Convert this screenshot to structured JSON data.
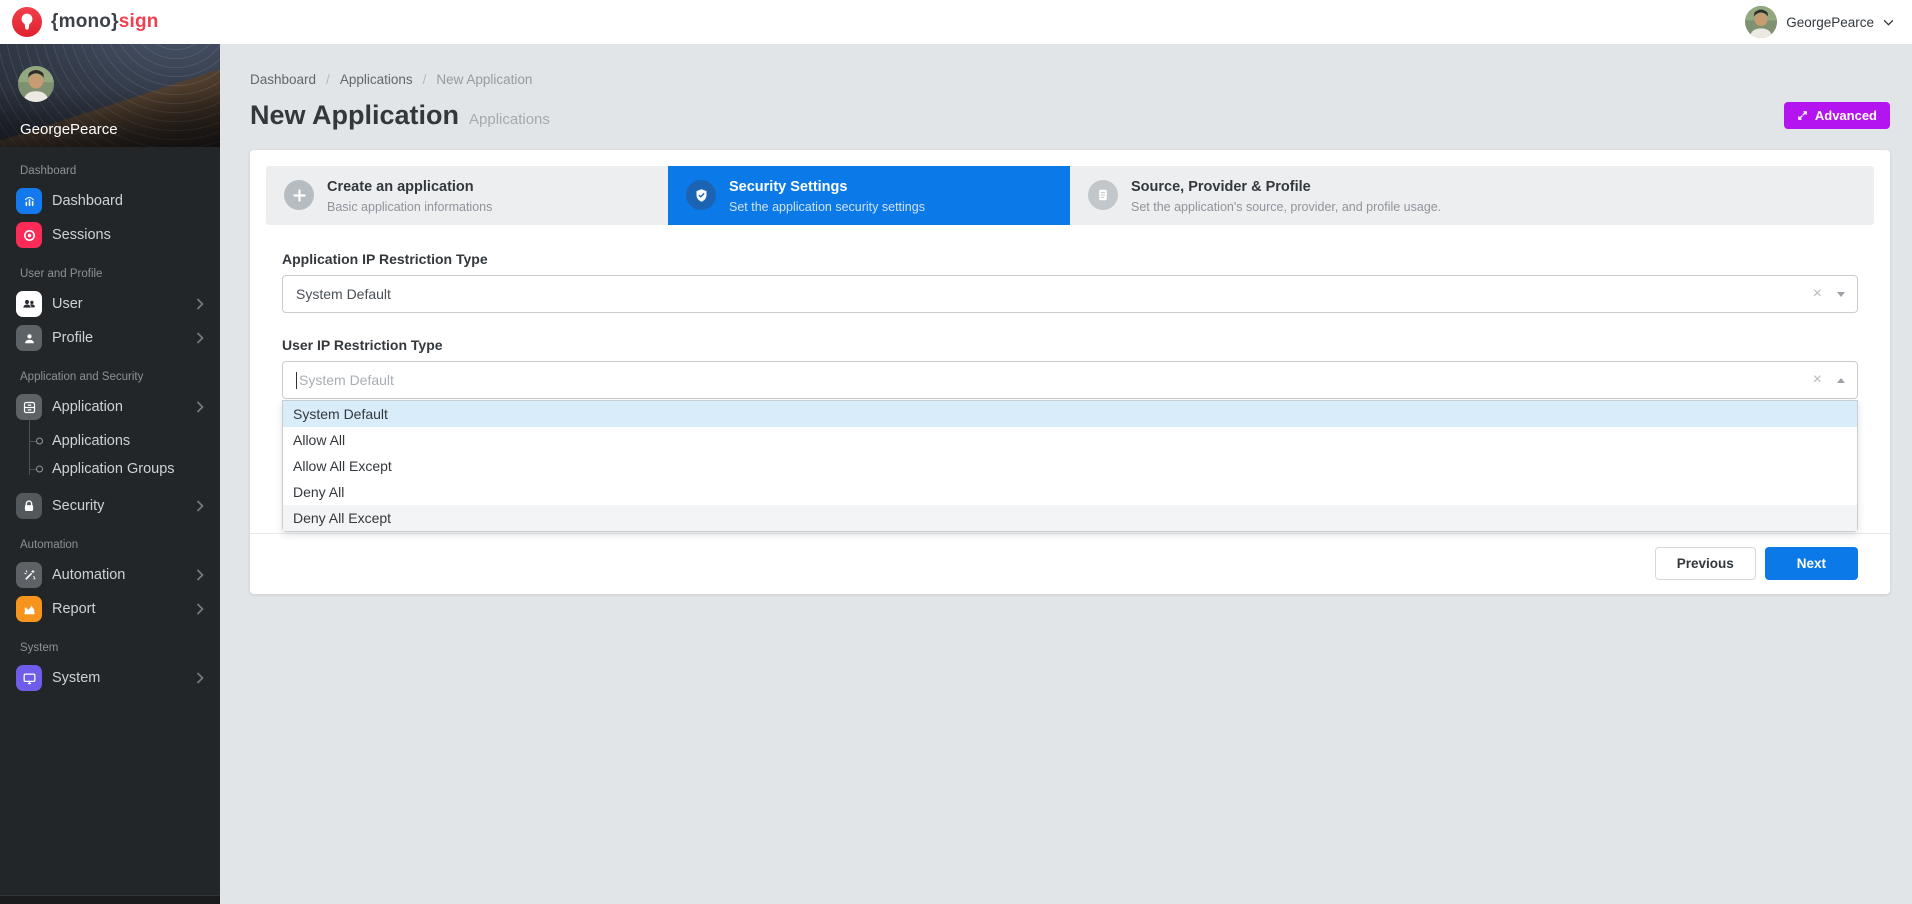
{
  "topbar": {
    "brand_left": "{mono}",
    "brand_right": "sign",
    "user_name": "GeorgePearce"
  },
  "sidebar": {
    "profile_name": "GeorgePearce",
    "sections": [
      {
        "label": "Dashboard",
        "items": [
          {
            "label": "Dashboard",
            "icon": "chart-icon"
          },
          {
            "label": "Sessions",
            "icon": "record-icon"
          }
        ]
      },
      {
        "label": "User and Profile",
        "items": [
          {
            "label": "User",
            "icon": "users-icon"
          },
          {
            "label": "Profile",
            "icon": "person-icon"
          }
        ]
      },
      {
        "label": "Application and Security",
        "items": [
          {
            "label": "Application",
            "icon": "archive-icon",
            "children": [
              "Applications",
              "Application Groups"
            ]
          },
          {
            "label": "Security",
            "icon": "lock-icon"
          }
        ]
      },
      {
        "label": "Automation",
        "items": [
          {
            "label": "Automation",
            "icon": "wand-icon"
          },
          {
            "label": "Report",
            "icon": "report-icon"
          }
        ]
      },
      {
        "label": "System",
        "items": [
          {
            "label": "System",
            "icon": "monitor-icon"
          }
        ]
      }
    ]
  },
  "breadcrumb": {
    "items": [
      "Dashboard",
      "Applications",
      "New Application"
    ],
    "separator": "/"
  },
  "page": {
    "title": "New Application",
    "subtitle": "Applications"
  },
  "toolbar": {
    "advanced_label": "Advanced"
  },
  "wizard": {
    "steps": [
      {
        "title": "Create an application",
        "subtitle": "Basic application informations",
        "state": "default"
      },
      {
        "title": "Security Settings",
        "subtitle": "Set the application security settings",
        "state": "active"
      },
      {
        "title": "Source, Provider & Profile",
        "subtitle": "Set the application's source, provider, and profile usage.",
        "state": "default"
      }
    ]
  },
  "form": {
    "fields": [
      {
        "label": "Application IP Restriction Type",
        "value": "System Default",
        "state": "closed"
      },
      {
        "label": "User IP Restriction Type",
        "placeholder": "System Default",
        "state": "open",
        "options": [
          {
            "label": "System Default",
            "state": "selected"
          },
          {
            "label": "Allow All",
            "state": "default"
          },
          {
            "label": "Allow All Except",
            "state": "default"
          },
          {
            "label": "Deny All",
            "state": "default"
          },
          {
            "label": "Deny All Except",
            "state": "hover"
          }
        ]
      }
    ],
    "buttons": {
      "previous": "Previous",
      "next": "Next"
    }
  },
  "colors": {
    "primary_blue": "#0b79e8",
    "advanced_magenta": "#b414ef",
    "sessions_red": "#fb2b57",
    "dashboard_blue": "#1379ec",
    "report_orange": "#f7941c",
    "system_purple": "#6f5ce8",
    "page_bg": "#e2e5e7",
    "sidebar_bg": "#232629",
    "option_selected_bg": "#d9ecfa"
  }
}
